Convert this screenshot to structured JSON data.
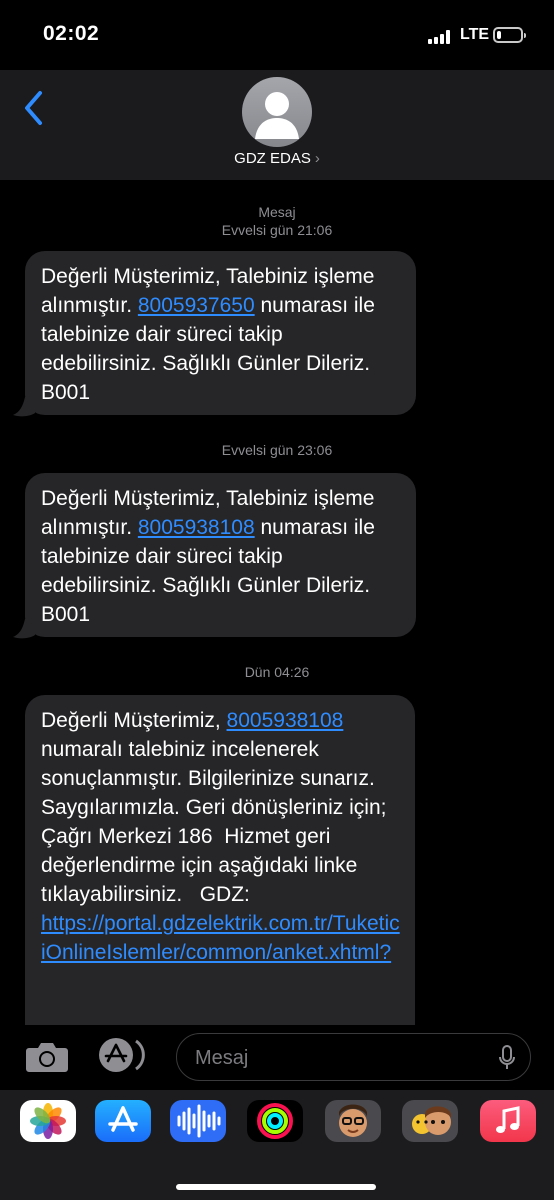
{
  "status_bar": {
    "time": "02:02",
    "network": "LTE",
    "battery_level": 0.2
  },
  "header": {
    "contact_name": "GDZ EDAS",
    "chevron": "›"
  },
  "messages": [
    {
      "meta_label": "Mesaj",
      "timestamp": "Evvelsi gün 21:06",
      "text_before": "Değerli Müşterimiz, Talebiniz işleme alınmıştır. ",
      "link": "8005937650",
      "text_after": " numarası ile talebinize dair süreci takip edebilirsiniz. Sağlıklı Günler Dileriz. B001"
    },
    {
      "timestamp": "Evvelsi gün 23:06",
      "text_before": "Değerli Müşterimiz, Talebiniz işleme alınmıştır. ",
      "link": "8005938108",
      "text_after": " numarası ile talebinize dair süreci takip edebilirsiniz. Sağlıklı Günler Dileriz. B001"
    },
    {
      "timestamp": "Dün 04:26",
      "text_before": "Değerli Müşterimiz, ",
      "link": "8005938108",
      "text_middle": " numaralı talebiniz incelenerek sonuçlanmıştır. Bilgilerinize sunarız. Saygılarımızla. Geri dönüşleriniz için; Çağrı Merkezi 186  Hizmet geri değerlendirme için aşağıdaki linke tıklayabilirsiniz.   GDZ: ",
      "url": "https://portal.gdzelektrik.com.tr/TuketiciOnlineIslemler/common/anket.xhtml?"
    }
  ],
  "input_bar": {
    "placeholder": "Mesaj",
    "left_icons": [
      "camera-icon",
      "app-store-icon"
    ],
    "right_icon": "microphone-icon"
  },
  "app_drawer": {
    "apps": [
      {
        "name": "photos-icon",
        "color": "#ffffff"
      },
      {
        "name": "app-store-icon",
        "color": "#1a8cff"
      },
      {
        "name": "audio-message-icon",
        "color": "#2f6df6"
      },
      {
        "name": "activity-icon",
        "color": "#000000"
      },
      {
        "name": "memoji-icon",
        "color": "#4a4a4e"
      },
      {
        "name": "animoji-icon",
        "color": "#4a4a4e"
      },
      {
        "name": "music-icon",
        "color": "#fa3e55"
      }
    ]
  },
  "colors": {
    "background": "#000000",
    "bubble": "#262629",
    "link": "#2f8cff",
    "header": "#1b1b1d",
    "meta_text": "#8e8e93"
  }
}
